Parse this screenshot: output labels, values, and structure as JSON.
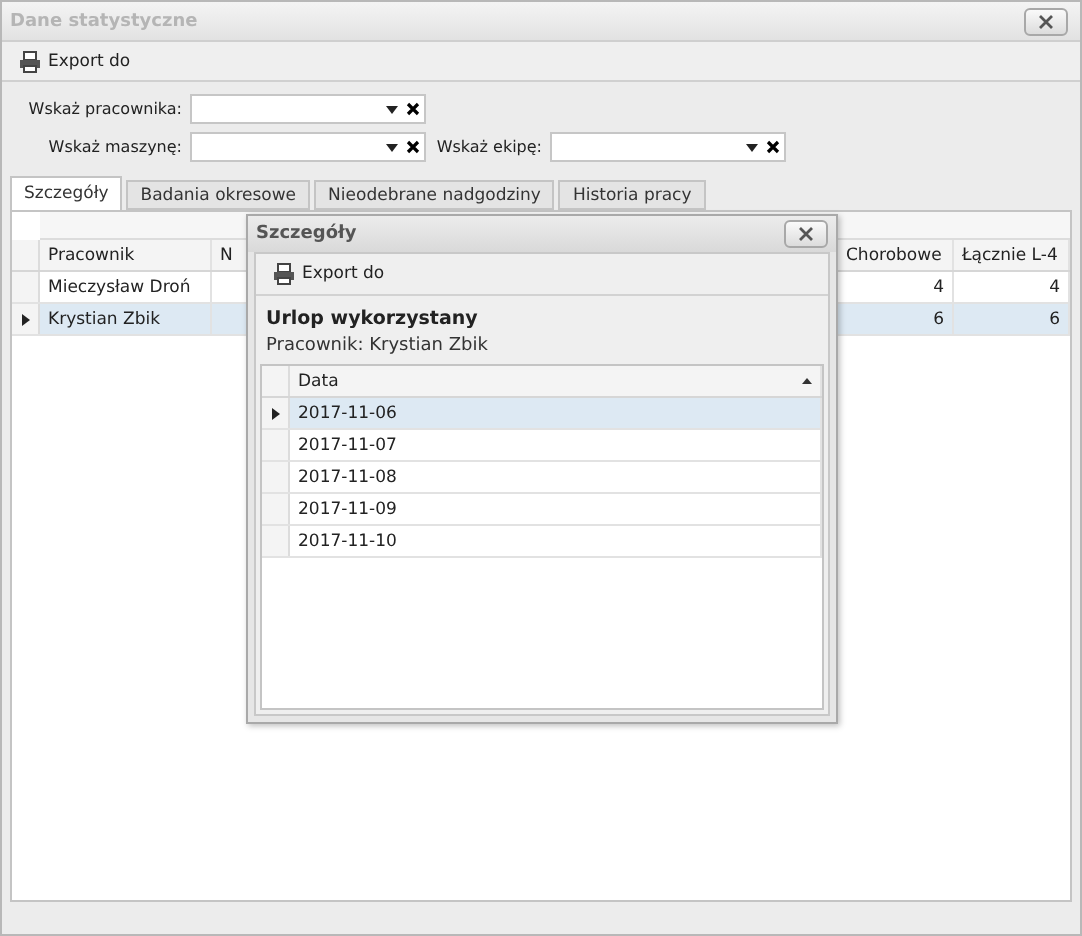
{
  "window": {
    "title": "Dane statystyczne",
    "active": false
  },
  "toolbar": {
    "export_label": "Export do"
  },
  "filters": [
    {
      "label": "Wskaż pracownika:"
    },
    {
      "label": "Wskaż maszynę:"
    },
    {
      "label": "Wskaż ekipę:"
    }
  ],
  "tabs": [
    {
      "label": "Szczegóły",
      "selected": true
    },
    {
      "label": "Badania okresowe",
      "selected": false
    },
    {
      "label": "Nieodebrane nadgodziny",
      "selected": false
    },
    {
      "label": "Historia pracy",
      "selected": false
    }
  ],
  "table": {
    "columns": [
      "Pracownik",
      "N",
      "Chorobowe",
      "Łącznie L-4"
    ],
    "rows": [
      {
        "cells": [
          "Mieczysław Droń",
          "",
          "4",
          "4"
        ],
        "selected": false
      },
      {
        "cells": [
          "Krystian Zbik",
          "",
          "6",
          "6"
        ],
        "selected": true
      }
    ]
  },
  "dialog": {
    "title": "Szczegóły",
    "export_label": "Export do",
    "heading": "Urlop wykorzystany",
    "subheading": "Pracownik: Krystian Zbik",
    "table": {
      "columns": [
        "Data"
      ],
      "rows": [
        {
          "cells": [
            "2017-11-06"
          ],
          "selected": true
        },
        {
          "cells": [
            "2017-11-07"
          ],
          "selected": false
        },
        {
          "cells": [
            "2017-11-08"
          ],
          "selected": false
        },
        {
          "cells": [
            "2017-11-09"
          ],
          "selected": false
        },
        {
          "cells": [
            "2017-11-10"
          ],
          "selected": false
        }
      ]
    }
  }
}
